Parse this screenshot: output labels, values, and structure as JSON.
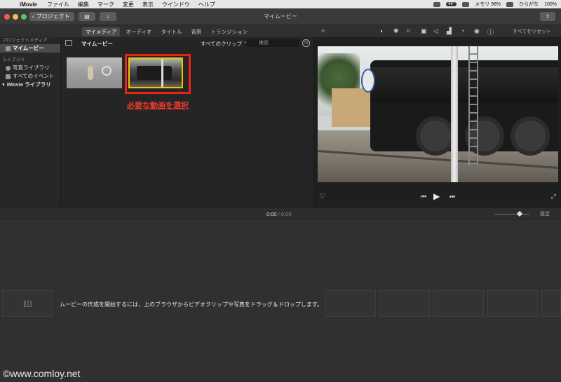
{
  "menubar": {
    "app": "iMovie",
    "items": [
      "ファイル",
      "編集",
      "マーク",
      "変更",
      "表示",
      "ウインドウ",
      "ヘルプ"
    ],
    "right": {
      "temp": "49°",
      "s_label": "メモリ 98%",
      "ime": "ひらがな",
      "battery": "100%"
    }
  },
  "titlebar": {
    "projects_label": "プロジェクト",
    "title": "マイムービー"
  },
  "tabs": [
    "マイメディア",
    "オーディオ",
    "タイトル",
    "背景",
    "トランジション"
  ],
  "sidebar": {
    "section1": "プロジェクトメディア",
    "project_item": "マイムービー",
    "section2": "ライブラリ",
    "items": [
      "写真ライブラリ",
      "すべてのイベント"
    ],
    "library": "iMovie ライブラリ"
  },
  "browser": {
    "title": "マイムービー",
    "filter": "すべてのクリップ",
    "search_placeholder": "検索",
    "annotation": "必要な動画を選択"
  },
  "viewer": {
    "reset_all": "すべてをリセット"
  },
  "timeline": {
    "current_time": "0:00",
    "separator": "/",
    "total_time": "0:00",
    "settings": "設定",
    "message": "ムービーの作成を開始するには、上のブラウザからビデオクリップや写真をドラッグ＆ドロップします。"
  },
  "watermark": "©www.comloy.net"
}
